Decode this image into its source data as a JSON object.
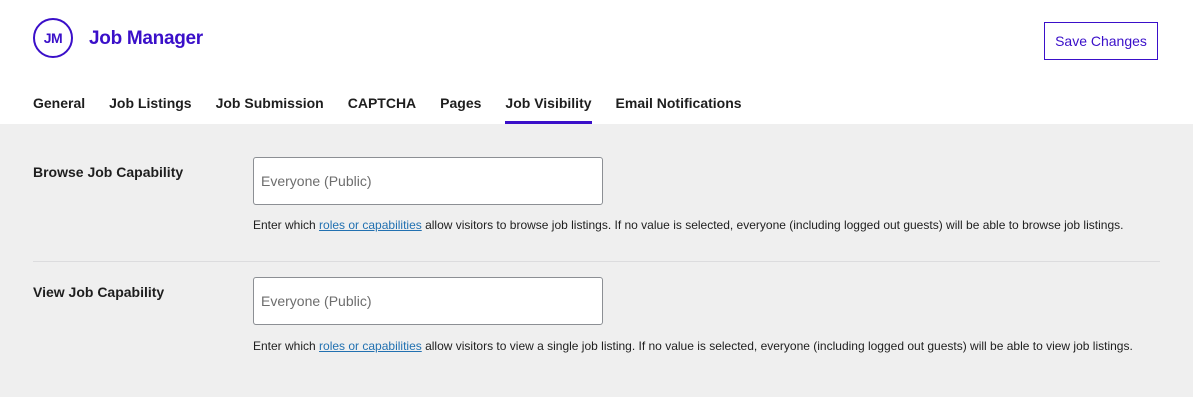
{
  "header": {
    "logo_text": "JM",
    "brand": "Job Manager",
    "save_label": "Save Changes"
  },
  "tabs": [
    {
      "label": "General",
      "active": false
    },
    {
      "label": "Job Listings",
      "active": false
    },
    {
      "label": "Job Submission",
      "active": false
    },
    {
      "label": "CAPTCHA",
      "active": false
    },
    {
      "label": "Pages",
      "active": false
    },
    {
      "label": "Job Visibility",
      "active": true
    },
    {
      "label": "Email Notifications",
      "active": false
    }
  ],
  "settings": [
    {
      "label": "Browse Job Capability",
      "placeholder": "Everyone (Public)",
      "desc_before": "Enter which ",
      "desc_link": "roles or capabilities",
      "desc_after": " allow visitors to browse job listings. If no value is selected, everyone (including logged out guests) will be able to browse job listings."
    },
    {
      "label": "View Job Capability",
      "placeholder": "Everyone (Public)",
      "desc_before": "Enter which ",
      "desc_link": "roles or capabilities",
      "desc_after": " allow visitors to view a single job listing. If no value is selected, everyone (including logged out guests) will be able to view job listings."
    }
  ],
  "colors": {
    "accent": "#3a0fc9",
    "link": "#2271b1",
    "panel_bg": "#efefef"
  }
}
